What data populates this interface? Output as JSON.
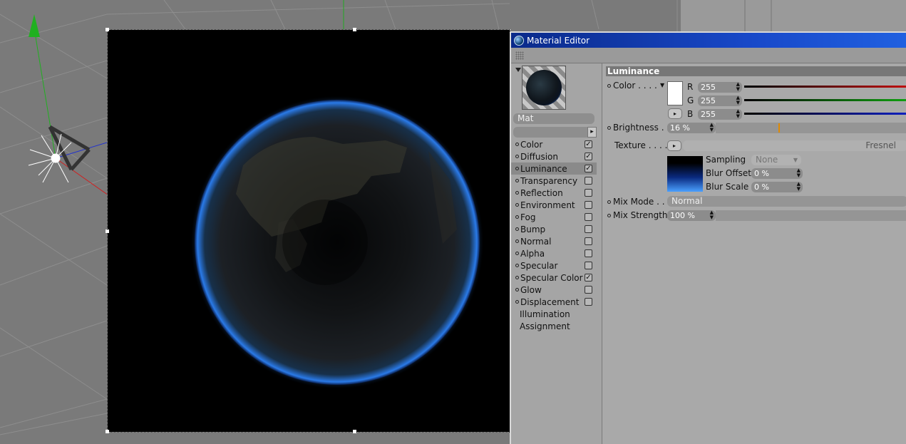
{
  "editor": {
    "title": "Material Editor",
    "material_name": "Mat",
    "channels": [
      {
        "label": "Color",
        "checked": true,
        "has_dot": true
      },
      {
        "label": "Diffusion",
        "checked": true,
        "has_dot": true
      },
      {
        "label": "Luminance",
        "checked": true,
        "has_dot": true
      },
      {
        "label": "Transparency",
        "checked": false,
        "has_dot": true
      },
      {
        "label": "Reflection",
        "checked": false,
        "has_dot": true
      },
      {
        "label": "Environment",
        "checked": false,
        "has_dot": true
      },
      {
        "label": "Fog",
        "checked": false,
        "has_dot": true
      },
      {
        "label": "Bump",
        "checked": false,
        "has_dot": true
      },
      {
        "label": "Normal",
        "checked": false,
        "has_dot": true
      },
      {
        "label": "Alpha",
        "checked": false,
        "has_dot": true
      },
      {
        "label": "Specular",
        "checked": false,
        "has_dot": true
      },
      {
        "label": "Specular Color",
        "checked": true,
        "has_dot": true
      },
      {
        "label": "Glow",
        "checked": false,
        "has_dot": true
      },
      {
        "label": "Displacement",
        "checked": false,
        "has_dot": true
      },
      {
        "label": "Illumination",
        "checked": null,
        "has_dot": false
      },
      {
        "label": "Assignment",
        "checked": null,
        "has_dot": false
      }
    ],
    "selected_channel": "Luminance",
    "section": {
      "title": "Luminance",
      "color_label": "Color",
      "rgb": [
        {
          "label": "R",
          "value": "255"
        },
        {
          "label": "G",
          "value": "255"
        },
        {
          "label": "B",
          "value": "255"
        }
      ],
      "brightness_label": "Brightness",
      "brightness_value": "16 %",
      "brightness_fraction": 0.16,
      "texture_label": "Texture",
      "texture_name": "Fresnel",
      "sampling_label": "Sampling",
      "sampling_value": "None",
      "blur_offset_label": "Blur Offset",
      "blur_offset_value": "0 %",
      "blur_scale_label": "Blur Scale",
      "blur_scale_value": "0 %",
      "mix_mode_label": "Mix Mode",
      "mix_mode_value": "Normal",
      "mix_strength_label": "Mix Strength",
      "mix_strength_value": "100 %"
    }
  },
  "colors": {
    "titlebar": "#1848c8",
    "glow": "#2a7ae8",
    "axis_x": "#d02020",
    "axis_y": "#20b020",
    "axis_z": "#2030d0"
  }
}
